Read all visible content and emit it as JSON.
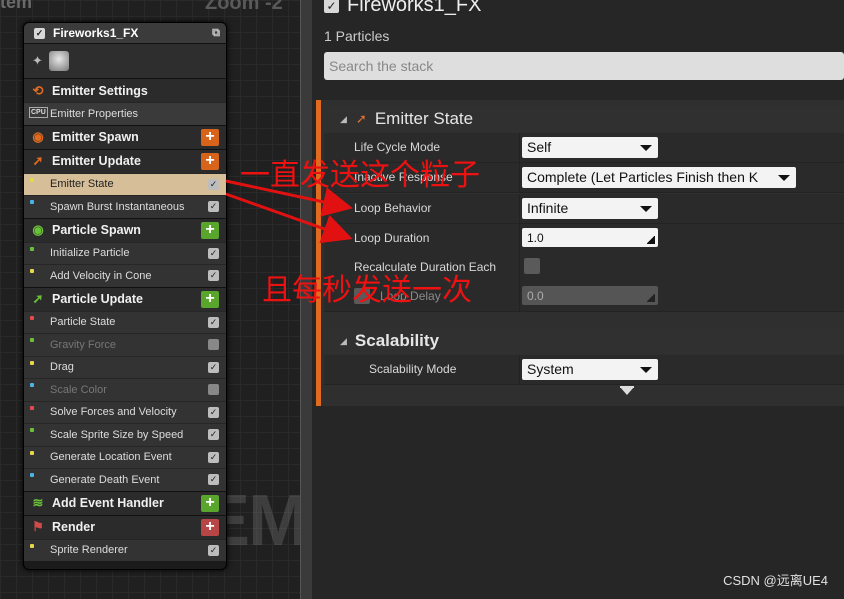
{
  "graph": {
    "top_label": "tem",
    "zoom_label": "Zoom -2",
    "watermark": "SYSTEM"
  },
  "node": {
    "title": "Fireworks1_FX",
    "sections": [
      {
        "type": "section",
        "label": "Emitter Settings",
        "icon": "emitter-settings-icon",
        "color": "#e06b1f"
      },
      {
        "type": "item",
        "label": "Emitter Properties",
        "cpu": "CPU"
      },
      {
        "type": "section",
        "label": "Emitter Spawn",
        "icon": "spawn-ring-icon",
        "color": "#e06b1f",
        "add": true,
        "add_color": "#d8641c"
      },
      {
        "type": "section",
        "label": "Emitter Update",
        "icon": "update-arrow-icon",
        "color": "#e06b1f",
        "add": true,
        "add_color": "#d8641c"
      },
      {
        "type": "item",
        "label": "Emitter State",
        "checked": true,
        "selected": true
      },
      {
        "type": "item",
        "label": "Spawn Burst Instantaneous",
        "checked": true
      },
      {
        "type": "section",
        "label": "Particle Spawn",
        "icon": "spawn-ring-icon",
        "color": "#6ac239",
        "add": true,
        "add_color": "#5aa52c"
      },
      {
        "type": "item",
        "label": "Initialize Particle",
        "checked": true
      },
      {
        "type": "item",
        "label": "Add Velocity in Cone",
        "checked": true
      },
      {
        "type": "section",
        "label": "Particle Update",
        "icon": "update-arrow-icon",
        "color": "#6ac239",
        "add": true,
        "add_color": "#5aa52c"
      },
      {
        "type": "item",
        "label": "Particle State",
        "checked": true
      },
      {
        "type": "item",
        "label": "Gravity Force",
        "checked": false
      },
      {
        "type": "item",
        "label": "Drag",
        "checked": true
      },
      {
        "type": "item",
        "label": "Scale Color",
        "checked": false
      },
      {
        "type": "item",
        "label": "Solve Forces and Velocity",
        "checked": true
      },
      {
        "type": "item",
        "label": "Scale Sprite Size by Speed",
        "checked": true
      },
      {
        "type": "item",
        "label": "Generate Location Event",
        "checked": true
      },
      {
        "type": "item",
        "label": "Generate Death Event",
        "checked": true
      },
      {
        "type": "section",
        "label": "Add Event Handler",
        "icon": "event-handler-icon",
        "color": "#6ac239",
        "add": true,
        "add_color": "#5aa52c"
      },
      {
        "type": "section",
        "label": "Render",
        "icon": "render-icon",
        "color": "#d04a4a",
        "add": true,
        "add_color": "#b84646"
      },
      {
        "type": "item",
        "label": "Sprite Renderer",
        "checked": true
      }
    ]
  },
  "details": {
    "title": "Fireworks1_FX",
    "particles": "1 Particles",
    "search_placeholder": "Search the stack",
    "emitter_state": {
      "header": "Emitter State",
      "life_cycle_mode": {
        "label": "Life Cycle Mode",
        "value": "Self"
      },
      "inactive_response": {
        "label": "Inactive Response",
        "value": "Complete (Let Particles Finish then K"
      },
      "loop_behavior": {
        "label": "Loop Behavior",
        "value": "Infinite"
      },
      "loop_duration": {
        "label": "Loop Duration",
        "value": "1.0"
      },
      "recalculate": {
        "label": "Recalculate Duration Each"
      },
      "loop_delay": {
        "label": "Loop Delay",
        "value": "0.0"
      }
    },
    "scalability": {
      "header": "Scalability",
      "mode": {
        "label": "Scalability Mode",
        "value": "System"
      }
    }
  },
  "annotations": {
    "top": "一直发送这个粒子",
    "bottom": "且每秒发送一次",
    "color": "#e11111"
  },
  "credit": "CSDN @远离UE4"
}
